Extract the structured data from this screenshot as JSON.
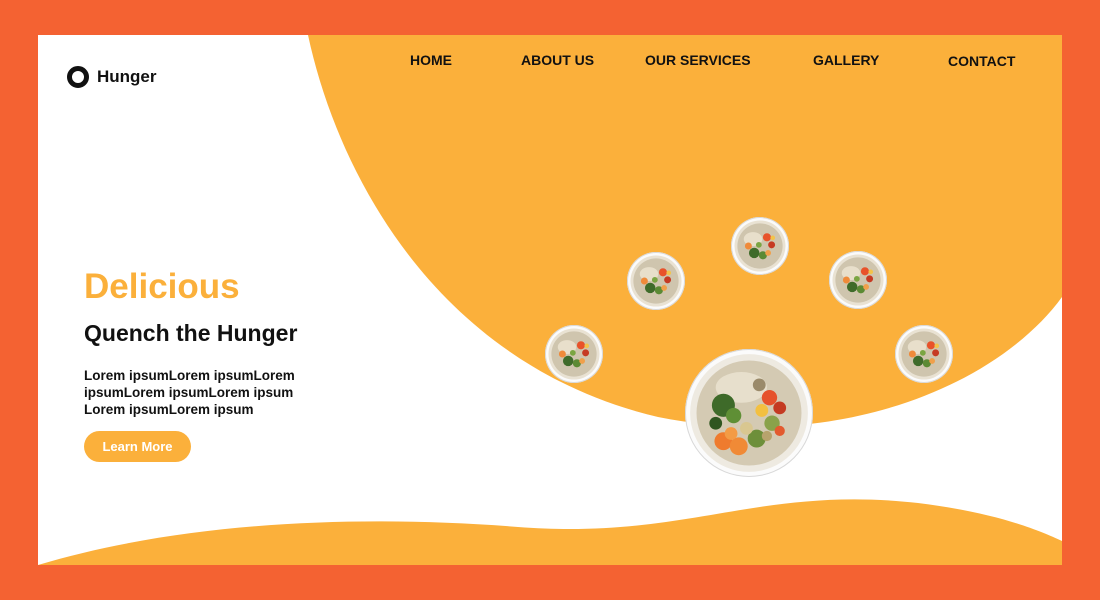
{
  "brand": {
    "name": "Hunger",
    "icon": "ring-logo-icon"
  },
  "nav": {
    "items": [
      {
        "label": "HOME"
      },
      {
        "label": "ABOUT US"
      },
      {
        "label": "OUR SERVICES"
      },
      {
        "label": "GALLERY"
      },
      {
        "label": "CONTACT"
      }
    ]
  },
  "hero": {
    "title": "Delicious",
    "subtitle": "Quench the Hunger",
    "body": "Lorem ipsumLorem ipsumLorem ipsumLorem ipsumLorem ipsum Lorem ipsumLorem ipsum",
    "cta_label": "Learn More"
  },
  "gallery": {
    "items": [
      {
        "name": "salad-bowl-image"
      },
      {
        "name": "salad-bowl-image"
      },
      {
        "name": "salad-bowl-image"
      },
      {
        "name": "salad-bowl-image"
      },
      {
        "name": "salad-bowl-image"
      },
      {
        "name": "salad-bowl-image"
      }
    ]
  },
  "colors": {
    "frame": "#f46232",
    "accent": "#fbb03b",
    "text": "#111111",
    "background": "#ffffff"
  }
}
